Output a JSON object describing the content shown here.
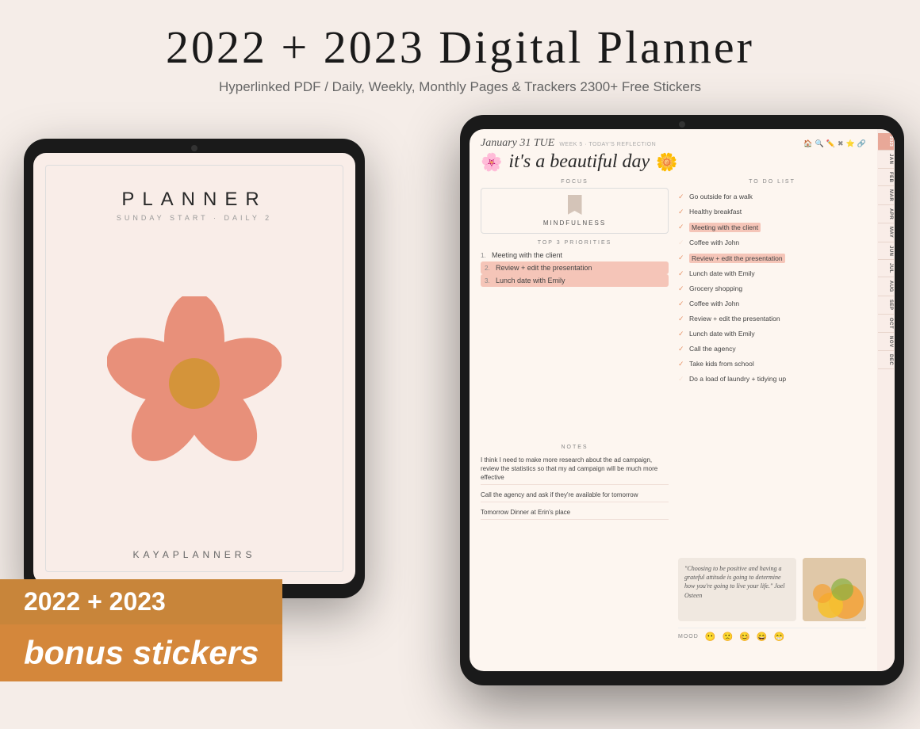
{
  "page": {
    "background": "#f5ede8",
    "title": "2022 + 2023 Digital Planner",
    "subtitle": "Hyperlinked PDF / Daily, Weekly, Monthly Pages & Trackers 2300+ Free Stickers"
  },
  "left_tablet": {
    "planner_title": "PLANNER",
    "planner_sub": "SUNDAY START · DAILY 2",
    "brand": "KAYAPLANNERS"
  },
  "bonus": {
    "year_label": "2022 + 2023",
    "sticker_label": "bonus stickers"
  },
  "right_tablet": {
    "date": "January 31 TUE",
    "week_info": "WEEK 5 · TODAY'S REFLECTION",
    "heading": "it's a beautiful day",
    "focus_label": "FOCUS",
    "focus_text": "MINDFULNESS",
    "priorities_label": "TOP 3 PRIORITIES",
    "priorities": [
      {
        "num": "1.",
        "text": "Meeting with the client",
        "highlight": false
      },
      {
        "num": "2.",
        "text": "Review + edit the presentation",
        "highlight": true
      },
      {
        "num": "3.",
        "text": "Lunch date with Emily",
        "highlight": true
      }
    ],
    "notes_label": "NOTES",
    "notes": [
      "I think I need to make more research about the ad campaign, review the statistics so that my ad campaign will be much more effective",
      "Call the agency and ask if they're available for tomorrow",
      "Tomorrow Dinner at Erin's place"
    ],
    "todo_label": "TO DO LIST",
    "todos": [
      {
        "text": "Go outside for a walk",
        "done": true,
        "highlight": false
      },
      {
        "text": "Healthy breakfast",
        "done": true,
        "highlight": false
      },
      {
        "text": "Meeting with the client",
        "done": true,
        "highlight": true
      },
      {
        "text": "Coffee with John",
        "done": false,
        "highlight": false
      },
      {
        "text": "Review + edit the presentation",
        "done": true,
        "highlight": true
      },
      {
        "text": "Lunch date with Emily",
        "done": true,
        "highlight": false
      },
      {
        "text": "Grocery shopping",
        "done": true,
        "highlight": false
      },
      {
        "text": "Coffee with John",
        "done": true,
        "highlight": false
      },
      {
        "text": "Review + edit the presentation",
        "done": true,
        "highlight": false
      },
      {
        "text": "Lunch date with Emily",
        "done": true,
        "highlight": false
      },
      {
        "text": "Call the agency",
        "done": true,
        "highlight": false
      },
      {
        "text": "Take kids from school",
        "done": true,
        "highlight": false
      },
      {
        "text": "Do a load of laundry + tidying up",
        "done": false,
        "highlight": false
      }
    ],
    "quote": "\"Choosing to be positive and having a grateful attitude is going to determine how you're going to live your life.\" Joel Osteen",
    "mood_label": "MOOD",
    "sidebar_tabs": [
      "2023",
      "JAN",
      "FEB",
      "MAR",
      "APR",
      "MAY",
      "JUN",
      "JUL",
      "AUG",
      "SEP",
      "OCT",
      "NOV",
      "DEC"
    ]
  }
}
